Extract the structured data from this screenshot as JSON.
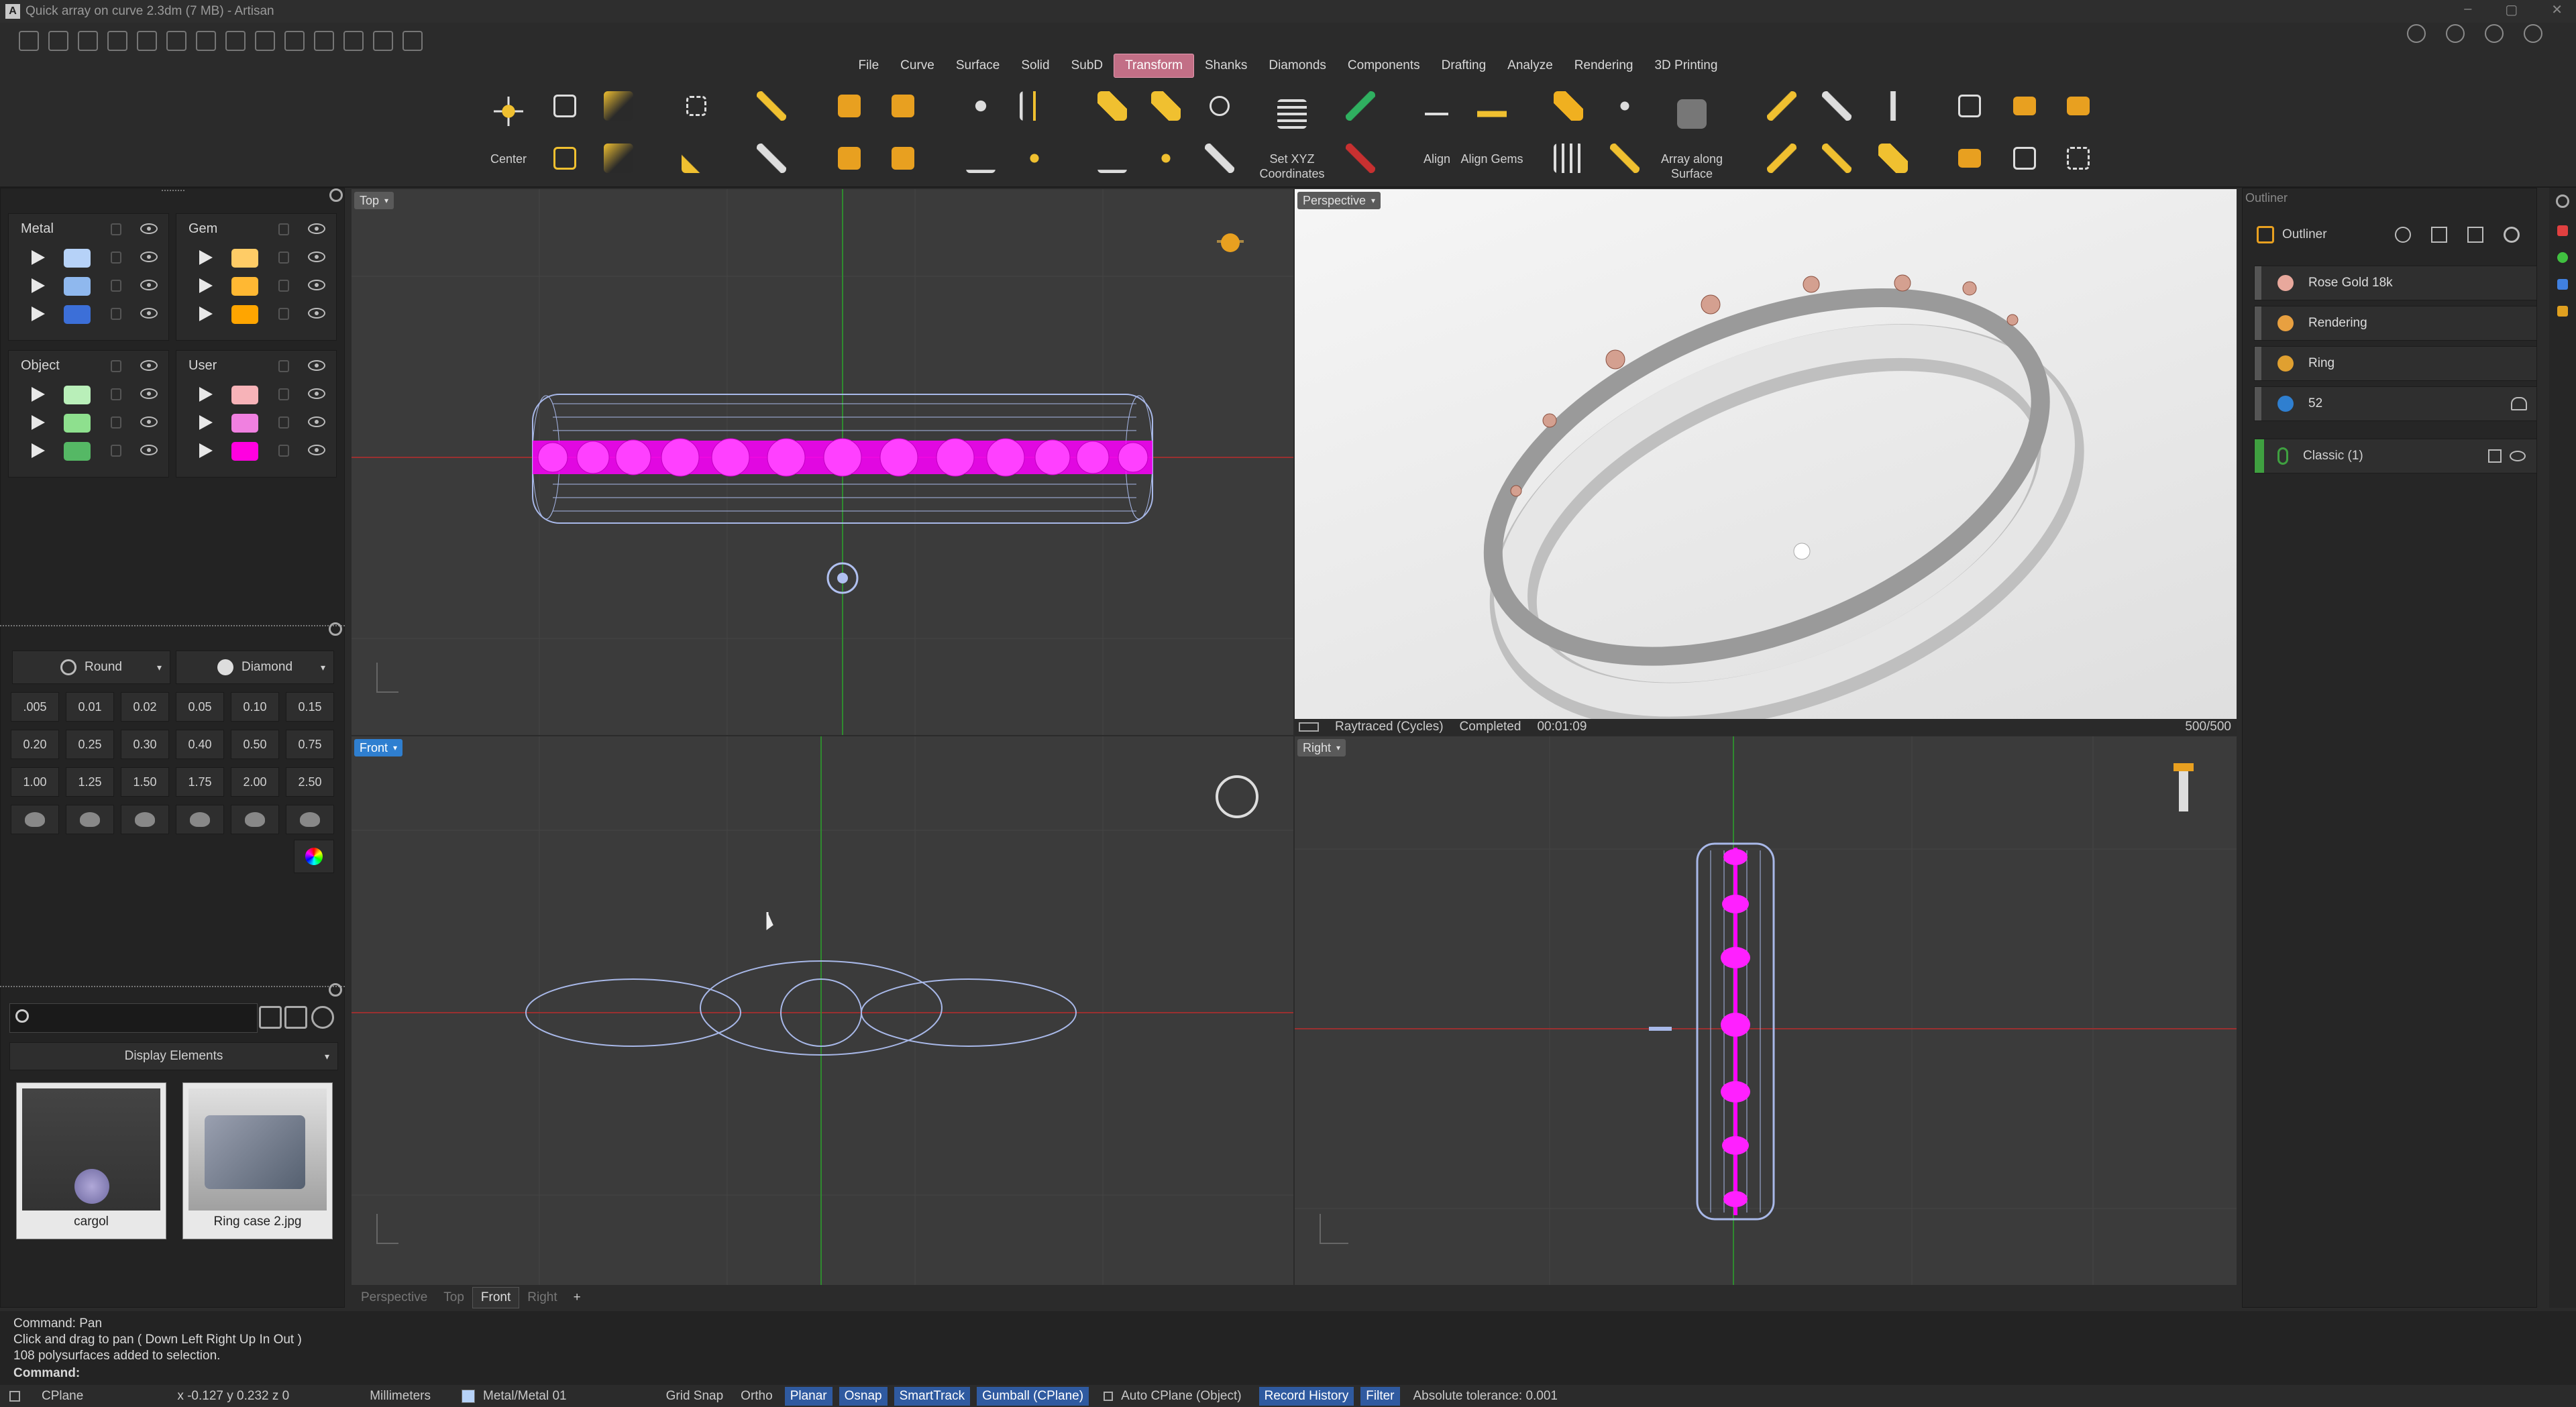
{
  "window": {
    "title": "Quick array on curve 2.3dm (7 MB) - Artisan"
  },
  "menu": {
    "items": [
      "File",
      "Curve",
      "Surface",
      "Solid",
      "SubD",
      "Transform",
      "Shanks",
      "Diamonds",
      "Components",
      "Drafting",
      "Analyze",
      "Rendering",
      "3D Printing"
    ],
    "active": "Transform"
  },
  "ribbon": {
    "center_label": "Center",
    "setxyz_label": "Set XYZ Coordinates",
    "align_label": "Align",
    "align_gems_label": "Align Gems",
    "array_surface_label": "Array along Surface"
  },
  "layers": {
    "metal": {
      "title": "Metal",
      "colors": [
        "#b6d2f8",
        "#8fb8ee",
        "#3c6fd8"
      ]
    },
    "gem": {
      "title": "Gem",
      "colors": [
        "#ffcc66",
        "#ffb833",
        "#ffa500"
      ]
    },
    "object": {
      "title": "Object",
      "colors": [
        "#b9efb9",
        "#8ee08e",
        "#55b865"
      ]
    },
    "user": {
      "title": "User",
      "colors": [
        "#f7b3b8",
        "#f080e0",
        "#ff00e0"
      ]
    }
  },
  "gems": {
    "shape_label": "Round",
    "cut_label": "Diamond",
    "sizes": [
      ".005",
      "0.01",
      "0.02",
      "0.05",
      "0.10",
      "0.15",
      "0.20",
      "0.25",
      "0.30",
      "0.40",
      "0.50",
      "0.75",
      "1.00",
      "1.25",
      "1.50",
      "1.75",
      "2.00",
      "2.50"
    ]
  },
  "library": {
    "search_placeholder": "",
    "display_label": "Display Elements",
    "items": [
      {
        "name": "cargol"
      },
      {
        "name": "Ring case 2.jpg"
      }
    ]
  },
  "viewports": {
    "top": {
      "label": "Top"
    },
    "perspective": {
      "label": "Perspective",
      "render_status": "Raytraced (Cycles)",
      "state": "Completed",
      "time": "00:01:09",
      "samples": "500/500"
    },
    "front": {
      "label": "Front"
    },
    "right": {
      "label": "Right"
    }
  },
  "viewport_tabs": [
    "Perspective",
    "Top",
    "Front",
    "Right"
  ],
  "active_viewport_tab": "Front",
  "outliner": {
    "panel_title": "Outliner",
    "header": "Outliner",
    "items": [
      {
        "label": "Rose Gold 18k",
        "color": "#e8a89c"
      },
      {
        "label": "Rendering",
        "color": "#e8a040"
      },
      {
        "label": "Ring",
        "color": "#e0a030"
      },
      {
        "label": "52",
        "color": "#2f7fd0"
      }
    ],
    "classic": "Classic (1)"
  },
  "command": {
    "history": [
      "Command: Pan",
      "Click and drag to pan ( Down  Left  Right  Up  In  Out )",
      "108 polysurfaces added to selection."
    ],
    "prompt": "Command:"
  },
  "statusbar": {
    "cplane": "CPlane",
    "coords": "x -0.127  y 0.232  z 0",
    "units": "Millimeters",
    "layer": "Metal/Metal 01",
    "toggles": [
      "Grid Snap",
      "Ortho",
      "Planar",
      "Osnap",
      "SmartTrack",
      "Gumball (CPlane)"
    ],
    "toggles_on": [
      false,
      false,
      true,
      true,
      true,
      true
    ],
    "auto_cplane": "Auto CPlane (Object)",
    "record_history": "Record History",
    "filter": "Filter",
    "tolerance": "Absolute tolerance: 0.001"
  }
}
